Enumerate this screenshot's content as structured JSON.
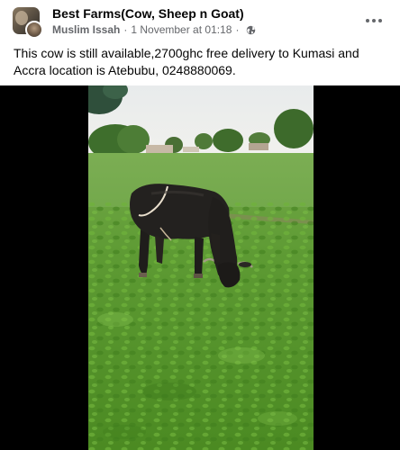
{
  "post": {
    "group_name": "Best Farms(Cow, Sheep n Goat)",
    "author": "Muslim Issah",
    "separator": "·",
    "timestamp": "1 November at 01:18",
    "separator2": "·",
    "privacy_icon": "globe-icon",
    "more_icon": "more-options-icon",
    "text": "This cow is still available,2700ghc free delivery to Kumasi and Accra location is Atebubu, 0248880069."
  },
  "media": {
    "type": "video",
    "subject": "black cow grazing on green field"
  },
  "colors": {
    "text_primary": "#050505",
    "text_secondary": "#65676b",
    "letterbox": "#000000"
  }
}
